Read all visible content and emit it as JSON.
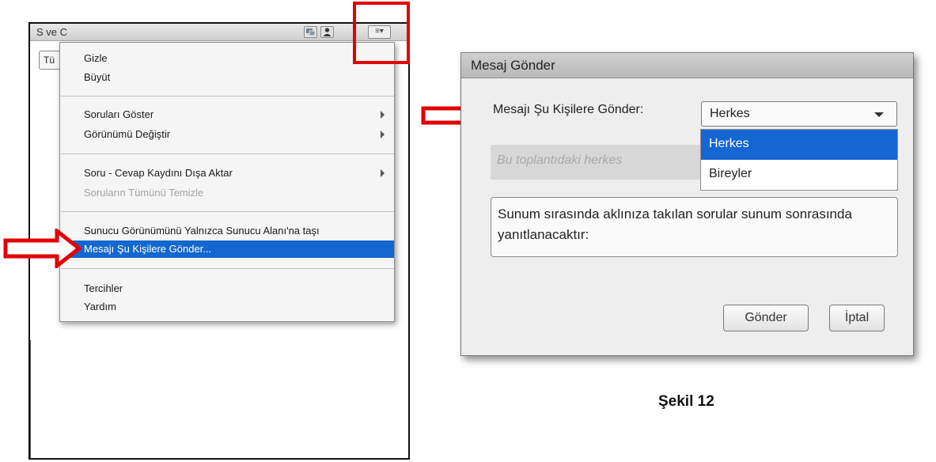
{
  "pod": {
    "title": "S ve C",
    "tab_stub": "Tü",
    "menu_glyph": "≡▾",
    "icons": [
      "monitor-icon",
      "person-icon"
    ]
  },
  "menu": {
    "items": [
      {
        "label": "Gizle",
        "state": "normal",
        "submenu": false
      },
      {
        "label": "Büyüt",
        "state": "normal",
        "submenu": false
      },
      {
        "label": "Soruları Göster",
        "state": "normal",
        "submenu": true
      },
      {
        "label": "Görünümü Değiştir",
        "state": "normal",
        "submenu": true
      },
      {
        "label": "Soru - Cevap Kaydını Dışa Aktar",
        "state": "normal",
        "submenu": true
      },
      {
        "label": "Soruların Tümünü Temizle",
        "state": "disabled",
        "submenu": false
      },
      {
        "label": "Sunucu Görünümünü Yalnızca Sunucu Alanı'na taşı",
        "state": "normal",
        "submenu": false
      },
      {
        "label": "Mesajı Şu Kişilere Gönder...",
        "state": "selected",
        "submenu": false
      },
      {
        "label": "Tercihler",
        "state": "normal",
        "submenu": false
      },
      {
        "label": "Yardım",
        "state": "normal",
        "submenu": false
      }
    ]
  },
  "dialog": {
    "title": "Mesaj Gönder",
    "send_to_label": "Mesajı Şu Kişilere Gönder:",
    "selected_value": "Herkes",
    "options": [
      "Herkes",
      "Bireyler"
    ],
    "recipient_placeholder": "Bu toplantıdaki herkes",
    "message": "Sunum sırasında aklınıza takılan sorular sunum sonrasında yanıtlanacaktır:",
    "send_button": "Gönder",
    "cancel_button": "İptal"
  },
  "caption": "Şekil 12",
  "colors": {
    "highlight_red": "#e30000",
    "selection_blue": "#1467cf"
  }
}
